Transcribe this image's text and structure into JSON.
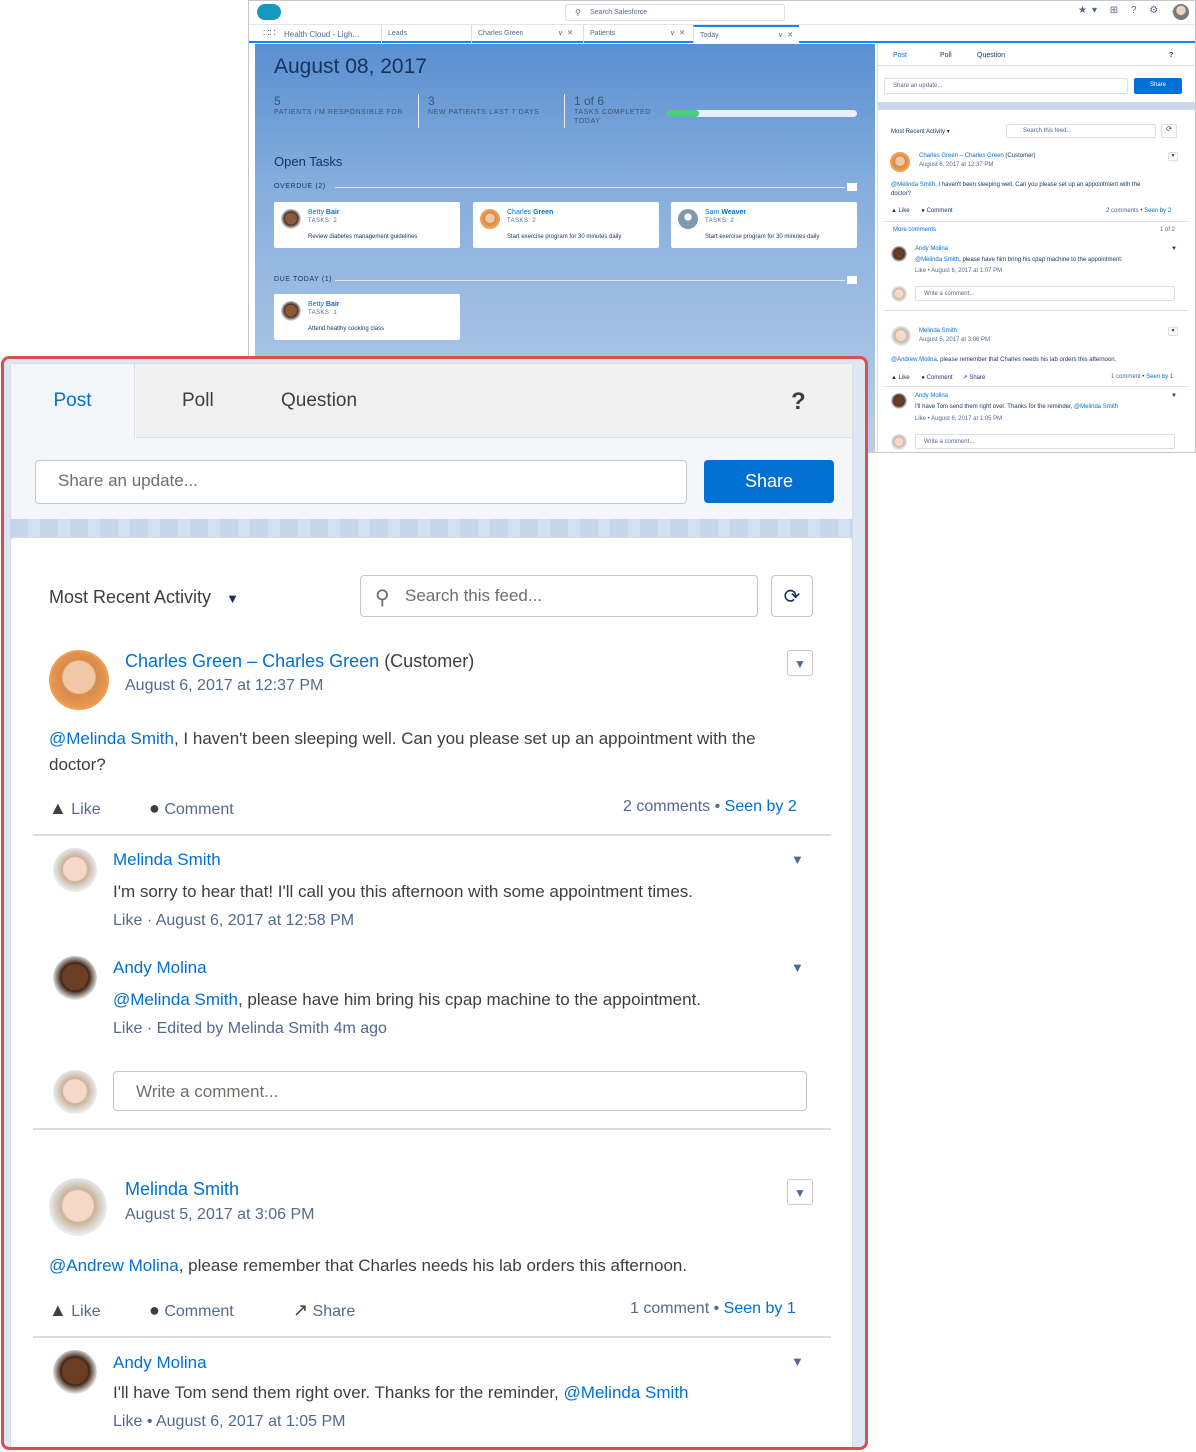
{
  "bg": {
    "search_placeholder": "Search Salesforce",
    "app_name": "Health Cloud - Ligh...",
    "tabs": [
      "Leads",
      "Charles Green",
      "Patients",
      "Today"
    ],
    "date": "August 08, 2017",
    "metrics": [
      {
        "value": "5",
        "label": "PATIENTS I'M RESPONSIBLE FOR"
      },
      {
        "value": "3",
        "label": "NEW PATIENTS LAST 7 DAYS"
      },
      {
        "value": "1 of 6",
        "label": "TASKS COMPLETED TODAY"
      }
    ],
    "tasks_progress": 0.1667,
    "open_tasks_title": "Open Tasks",
    "overdue_label": "OVERDUE (2)",
    "due_today_label": "DUE TODAY (1)",
    "overdue_tasks": [
      {
        "first": "Betty",
        "last": "Bair",
        "count": "TASKS: 2",
        "desc": "Review diabetes management guidelines"
      },
      {
        "first": "Charles",
        "last": "Green",
        "count": "TASKS: 2",
        "desc": "Start exercise program for 30 minutes daily"
      },
      {
        "first": "Sam",
        "last": "Weaver",
        "count": "TASKS: 2",
        "desc": "Start exercise program for 30 minutes daily"
      }
    ],
    "due_today_tasks": [
      {
        "first": "Betty",
        "last": "Bair",
        "count": "TASKS: 1",
        "desc": "Attend healthy cooking class"
      }
    ],
    "mini_feed": {
      "more_comments": "More comments",
      "page_count": "1 of 2",
      "p1_comment_text": ", please have him bring his cpap machine to the appointment.",
      "p1_comment_time": "Like  •  August 6, 2017 at 1:07 PM",
      "p2_comment_time": "Like  •  August 6, 2017 at 1:05 PM"
    }
  },
  "publisher": {
    "tabs": {
      "post": "Post",
      "poll": "Poll",
      "question": "Question"
    },
    "help": "?",
    "placeholder": "Share an update...",
    "share_label": "Share"
  },
  "feed": {
    "sort_label": "Most Recent Activity",
    "search_placeholder": "Search this feed...",
    "posts": [
      {
        "author": "Charles Green",
        "separator": "–",
        "target": "Charles Green",
        "role": "(Customer)",
        "timestamp": "August 6, 2017 at 12:37 PM",
        "mention": "@Melinda Smith",
        "body_line1": ", I haven't been sleeping well. Can you please set up an appointment with the",
        "body_line2": "doctor?",
        "actions": {
          "like": "Like",
          "comment": "Comment"
        },
        "comments_count": "2 comments",
        "dot": "•",
        "seen_by": "Seen by 2",
        "comments": [
          {
            "author": "Melinda Smith",
            "text": "I'm sorry to hear that! I'll call you this afternoon with some appointment times.",
            "like": "Like",
            "dot": "·",
            "meta": "August 6, 2017 at 12:58 PM"
          },
          {
            "author": "Andy Molina",
            "mention": "@Melinda Smith",
            "text": ", please have him bring his cpap machine to the appointment.",
            "like": "Like",
            "dot": "·",
            "meta": "Edited by Melinda Smith 4m ago"
          }
        ],
        "comment_placeholder": "Write a comment..."
      },
      {
        "author": "Melinda Smith",
        "timestamp": "August 5, 2017 at 3:06 PM",
        "mention": "@Andrew Molina",
        "body": ", please remember that Charles needs his lab orders this afternoon.",
        "actions": {
          "like": "Like",
          "comment": "Comment",
          "share": "Share"
        },
        "comments_count": "1 comment",
        "dot": "•",
        "seen_by": "Seen by 1",
        "comments": [
          {
            "author": "Andy Molina",
            "text": "I'll have Tom send them right over. Thanks for the reminder,",
            "mention": "@Melinda Smith",
            "like": "Like",
            "dot": "•",
            "meta": "August 6, 2017 at 1:05 PM"
          }
        ]
      }
    ]
  },
  "icons": {
    "search": "search-icon",
    "refresh": "refresh-icon",
    "like": "like-icon",
    "comment": "comment-icon",
    "share": "share-icon",
    "dropdown": "chevron-down-icon",
    "help": "help-icon"
  },
  "colors": {
    "brand_blue": "#0070d2",
    "callout_border": "#d9504c",
    "progress_green": "#4bca81",
    "feed_background": "#dde6f2"
  }
}
